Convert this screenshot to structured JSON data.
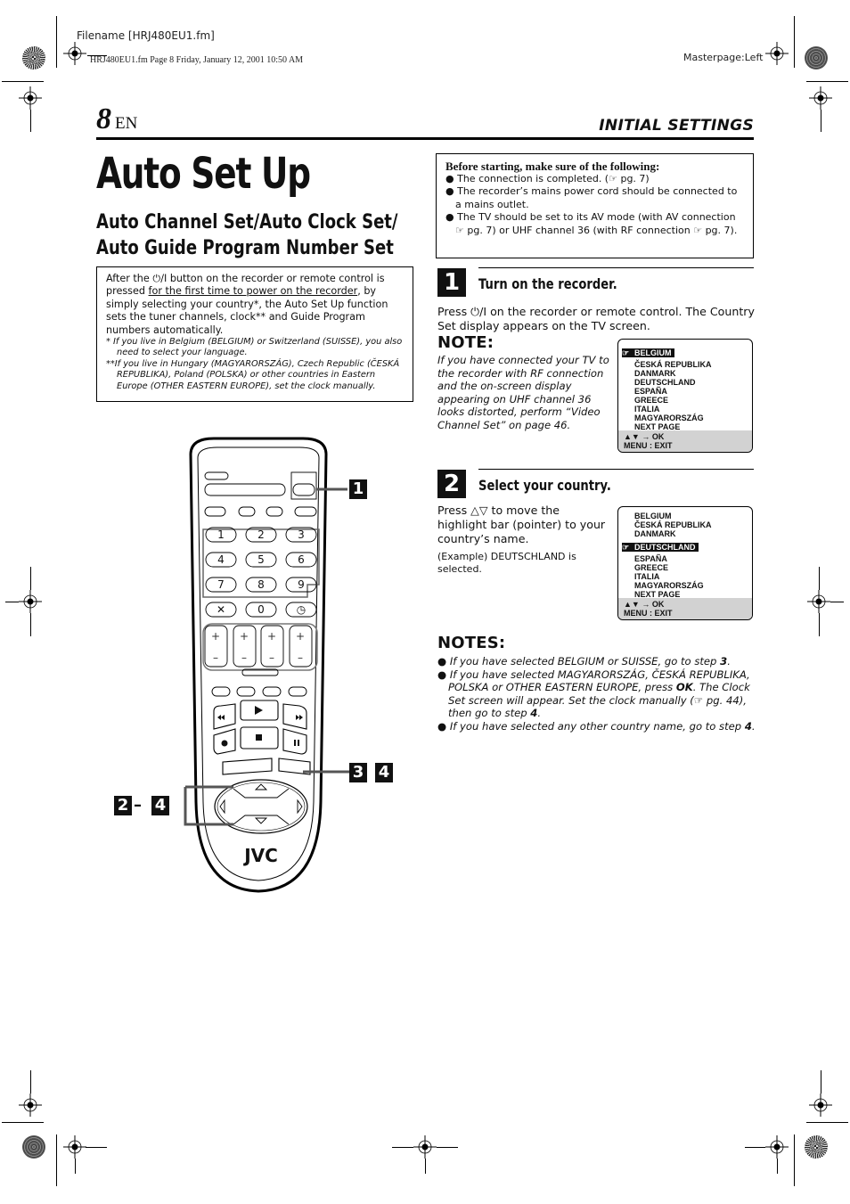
{
  "print_header": {
    "filename": "Filename [HRJ480EU1.fm]",
    "print_line": "HRJ480EU1.fm  Page 8  Friday, January 12, 2001  10:50 AM",
    "masterpage": "Masterpage:Left"
  },
  "page": {
    "number": "8",
    "lang": "EN",
    "section": "INITIAL SETTINGS"
  },
  "title": "Auto Set Up",
  "subtitle_lines": [
    "Auto Channel Set/Auto Clock Set/",
    "Auto Guide Program Number Set"
  ],
  "intro": {
    "p1_a": "After the ",
    "power_symbol": "⏻/I",
    "p1_b": " button on the recorder or remote control is pressed ",
    "p1_underline": "for the first time to power on the recorder",
    "p1_c": ", by simply selecting your country*, the Auto Set Up function sets the tuner channels, clock** and Guide Program numbers automatically.",
    "footnote1": "*  If you live in Belgium (BELGIUM) or Switzerland (SUISSE), you also need to select your language.",
    "footnote2": "**If you live in Hungary (MAGYARORSZÁG), Czech Republic (ČESKÁ REPUBLIKA), Poland (POLSKA) or other countries in Eastern Europe (OTHER EASTERN EUROPE), set the clock manually."
  },
  "before": {
    "heading": "Before starting, make sure of the following:",
    "items": [
      "The connection is completed. (☞ pg. 7)",
      "The recorder’s mains power cord should be connected to a mains outlet.",
      "The TV should be set to its AV mode (with AV connection ☞ pg. 7) or UHF channel 36 (with RF connection ☞ pg. 7)."
    ]
  },
  "step1": {
    "num": "1",
    "title": "Turn on the recorder.",
    "text": "Press ⏻/I on the recorder or remote control. The Country Set display appears on the TV screen.",
    "note_heading": "NOTE:",
    "note_text": "If you have connected your TV to the recorder with RF connection and the on-screen display appearing on UHF channel 36 looks distorted, perform “Video Channel Set” on page 46.",
    "screen": {
      "pointer": "☞",
      "items": [
        "BELGIUM",
        "ČESKÁ REPUBLIKA",
        "DANMARK",
        "DEUTSCHLAND",
        "ESPAÑA",
        "GREECE",
        "ITALIA",
        "MAGYARORSZÁG",
        "NEXT PAGE"
      ],
      "selected_index": 0,
      "footer_line1": "▲▼ → OK",
      "footer_line2": "MENU : EXIT"
    }
  },
  "step2": {
    "num": "2",
    "title": "Select your country.",
    "text": "Press △▽ to move the highlight bar (pointer) to your country’s name.",
    "example": "(Example) DEUTSCHLAND is selected.",
    "screen": {
      "pointer": "☞",
      "items": [
        "BELGIUM",
        "ČESKÁ REPUBLIKA",
        "DANMARK",
        "DEUTSCHLAND",
        "ESPAÑA",
        "GREECE",
        "ITALIA",
        "MAGYARORSZÁG",
        "NEXT PAGE"
      ],
      "selected_index": 3,
      "footer_line1": "▲▼ → OK",
      "footer_line2": "MENU : EXIT"
    }
  },
  "notes": {
    "heading": "NOTES:",
    "items": [
      {
        "a": "If you have selected BELGIUM or SUISSE, go to step ",
        "b": "3",
        "c": "."
      },
      {
        "a": "If you have selected MAGYARORSZÁG, ČESKÁ REPUBLIKA, POLSKA or OTHER EASTERN EUROPE, press ",
        "b": "OK",
        "c": ". The Clock Set screen will appear. Set the clock manually (☞ pg. 44), then go to step ",
        "d": "4",
        "e": "."
      },
      {
        "a": "If you have selected any other country name, go to step ",
        "b": "4",
        "c": "."
      }
    ]
  },
  "remote": {
    "brand": "JVC",
    "keypad": [
      "1",
      "2",
      "3",
      "4",
      "5",
      "6",
      "7",
      "8",
      "9",
      "✕",
      "0",
      "◷"
    ],
    "callouts": {
      "power": "1",
      "ok_a": "3",
      "ok_b": "4",
      "nav_a": "2",
      "nav_dash": "–",
      "nav_b": "4"
    },
    "mini_labels": {
      "keypad_2": "2",
      "timer_4": "4",
      "row_1": "1"
    }
  }
}
